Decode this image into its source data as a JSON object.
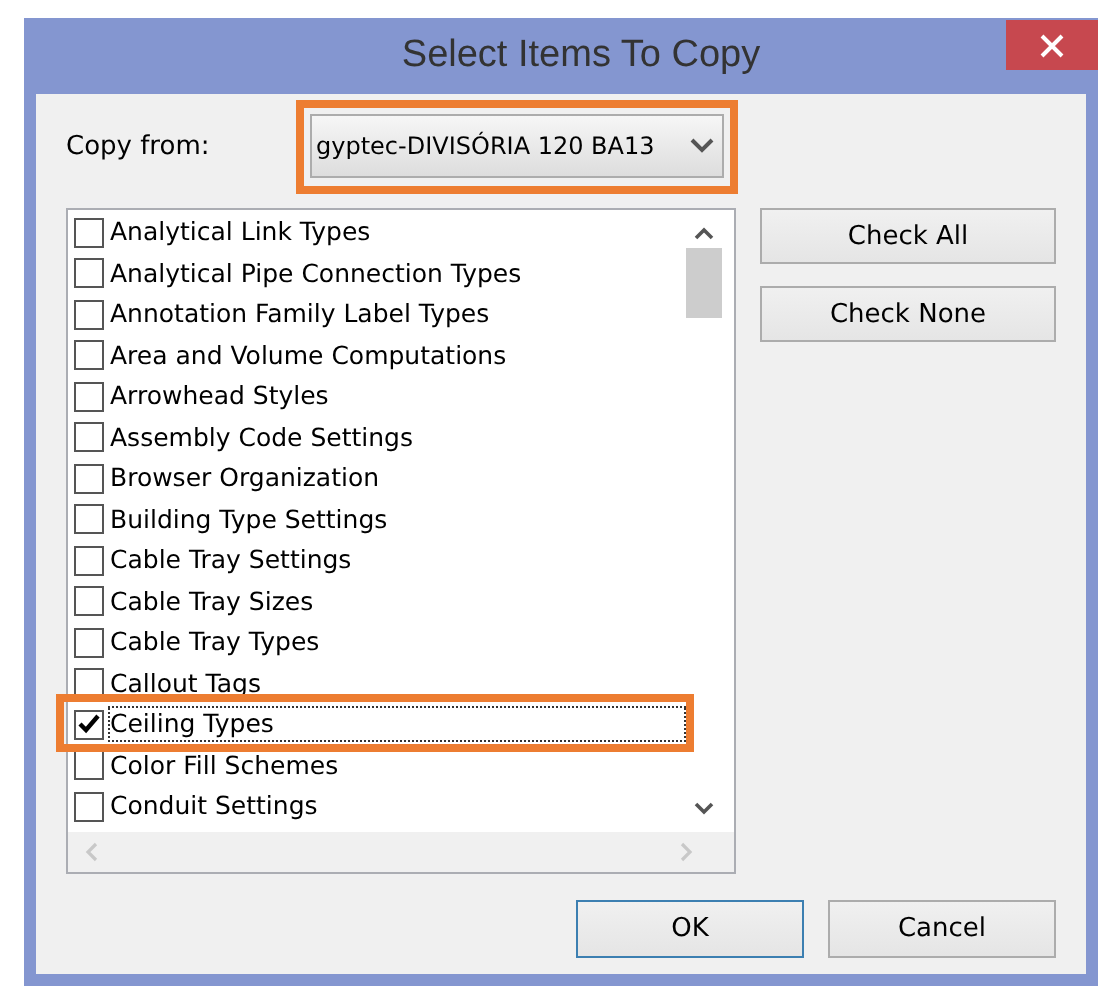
{
  "window": {
    "title": "Select Items To Copy"
  },
  "copy_from": {
    "label": "Copy from:",
    "value": "gyptec-DIVISÓRIA 120 BA13",
    "highlighted": true
  },
  "items": [
    {
      "label": "Analytical Link Types",
      "checked": false,
      "focused": false,
      "highlighted": false
    },
    {
      "label": "Analytical Pipe Connection Types",
      "checked": false,
      "focused": false,
      "highlighted": false
    },
    {
      "label": "Annotation Family Label Types",
      "checked": false,
      "focused": false,
      "highlighted": false
    },
    {
      "label": "Area and Volume Computations",
      "checked": false,
      "focused": false,
      "highlighted": false
    },
    {
      "label": "Arrowhead Styles",
      "checked": false,
      "focused": false,
      "highlighted": false
    },
    {
      "label": "Assembly Code Settings",
      "checked": false,
      "focused": false,
      "highlighted": false
    },
    {
      "label": "Browser Organization",
      "checked": false,
      "focused": false,
      "highlighted": false
    },
    {
      "label": "Building Type Settings",
      "checked": false,
      "focused": false,
      "highlighted": false
    },
    {
      "label": "Cable Tray Settings",
      "checked": false,
      "focused": false,
      "highlighted": false
    },
    {
      "label": "Cable Tray Sizes",
      "checked": false,
      "focused": false,
      "highlighted": false
    },
    {
      "label": "Cable Tray Types",
      "checked": false,
      "focused": false,
      "highlighted": false
    },
    {
      "label": "Callout Tags",
      "checked": false,
      "focused": false,
      "highlighted": false
    },
    {
      "label": "Ceiling Types",
      "checked": true,
      "focused": true,
      "highlighted": true
    },
    {
      "label": "Color Fill Schemes",
      "checked": false,
      "focused": false,
      "highlighted": false
    },
    {
      "label": "Conduit Settings",
      "checked": false,
      "focused": false,
      "highlighted": false
    }
  ],
  "side_buttons": [
    "Check All",
    "Check None"
  ],
  "buttons": [
    {
      "label": "OK",
      "default": true
    },
    {
      "label": "Cancel",
      "default": false
    }
  ]
}
